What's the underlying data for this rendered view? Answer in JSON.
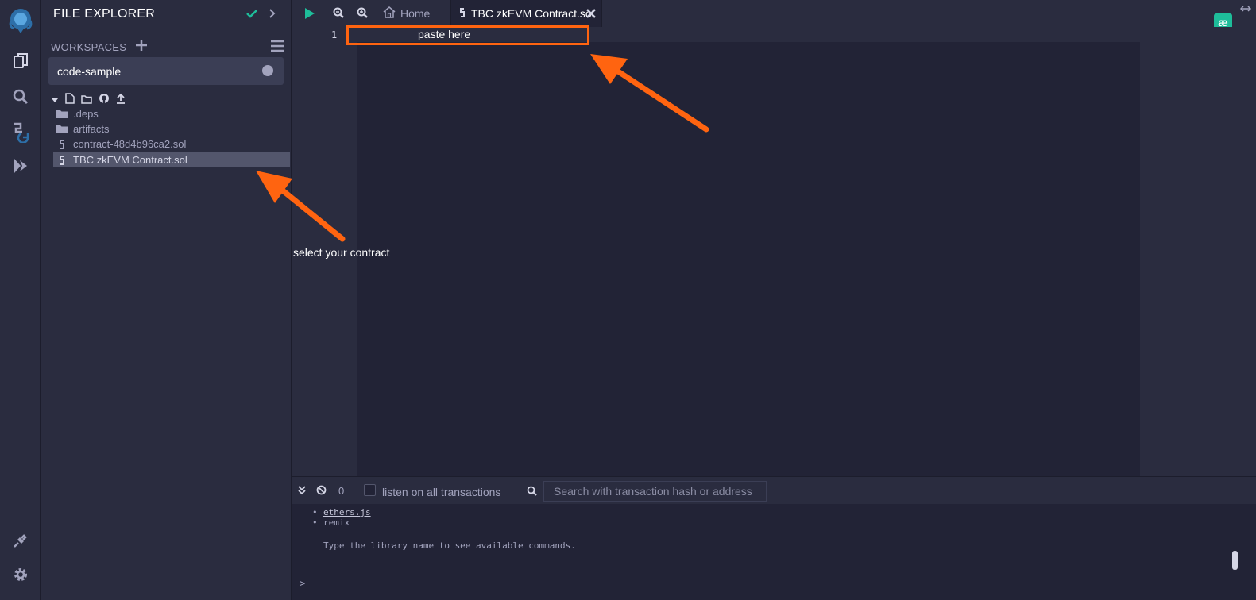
{
  "sidebar": {
    "title": "FILE EXPLORER",
    "workspaces_label": "WORKSPACES",
    "workspace_selected": "code-sample",
    "files": [
      {
        "name": ".deps",
        "type": "folder"
      },
      {
        "name": "artifacts",
        "type": "folder"
      },
      {
        "name": "contract-48d4b96ca2.sol",
        "type": "solidity"
      },
      {
        "name": "TBC zkEVM Contract.sol",
        "type": "solidity",
        "selected": true
      }
    ]
  },
  "editor": {
    "tabs": [
      {
        "label": "Home"
      },
      {
        "label": "TBC zkEVM Contract.sol",
        "active": true
      }
    ],
    "line_numbers": [
      "1"
    ]
  },
  "annotations": {
    "paste": "paste here",
    "select": "select your contract",
    "color": "#ff6410"
  },
  "terminal": {
    "count": "0",
    "listen_label": "listen on all transactions",
    "search_placeholder": "Search with transaction hash or address",
    "lines": [
      {
        "text": "ethers.js",
        "link": true
      },
      {
        "text": "remix",
        "link": false
      }
    ],
    "help": "Type the library name to see available commands.",
    "prompt": ">"
  },
  "colors": {
    "accent_green": "#1ebd9a",
    "panel_bg": "#2a2c3f",
    "editor_bg": "#222336"
  }
}
